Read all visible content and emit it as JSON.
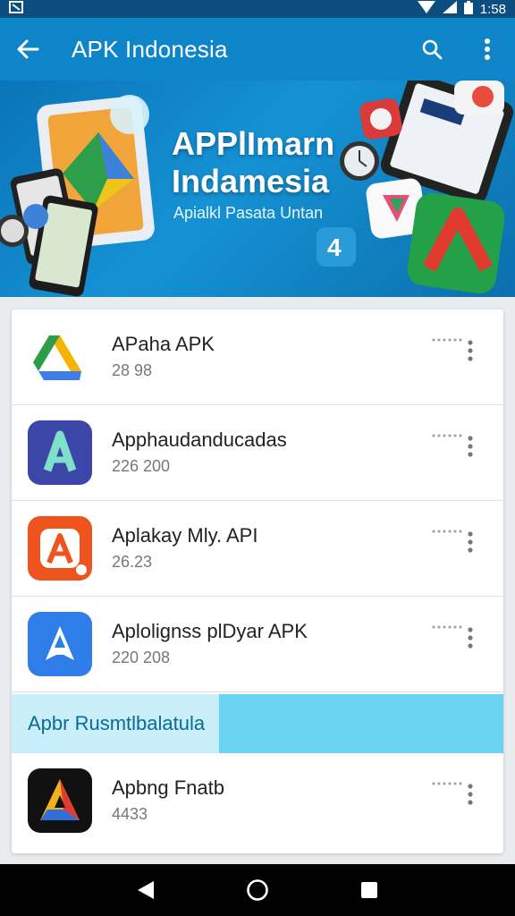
{
  "status_bar": {
    "time": "1:58",
    "icons": [
      "notification-icon",
      "wifi-icon",
      "signal-icon",
      "battery-icon"
    ]
  },
  "app_bar": {
    "title": "APK Indonesia",
    "icons": [
      "back-arrow-icon",
      "search-icon",
      "more-vert-icon"
    ]
  },
  "banner": {
    "title_line1": "APPlImarn",
    "title_line2": "Indamesia",
    "subtitle": "Apialkl Pasata Untan"
  },
  "apps": [
    {
      "name": "APaha APK",
      "meta": "28 98",
      "icon": "google-drive-style-icon"
    },
    {
      "name": "Apphaudanducadas",
      "meta": "226 200",
      "icon": "blue-a-app-icon"
    },
    {
      "name": "Aplakay Mly. API",
      "meta": "26.23",
      "icon": "orange-a-app-icon"
    },
    {
      "name": "Aplolignss plDyar APK",
      "meta": "220 208",
      "icon": "light-blue-a-app-icon"
    }
  ],
  "section": {
    "label": "Apbr Rusmtlbalatula"
  },
  "apps_after_section": [
    {
      "name": "Apbng Fnatb",
      "meta": "4433",
      "icon": "black-a-app-icon"
    }
  ],
  "nav_bar": {
    "icons": [
      "back-triangle-icon",
      "home-circle-icon",
      "recents-square-icon"
    ]
  },
  "colors": {
    "app_bar": "#0f85c9",
    "status_bar": "#0b4f80",
    "section": "#69d3f1",
    "nav_bar": "#000000"
  }
}
